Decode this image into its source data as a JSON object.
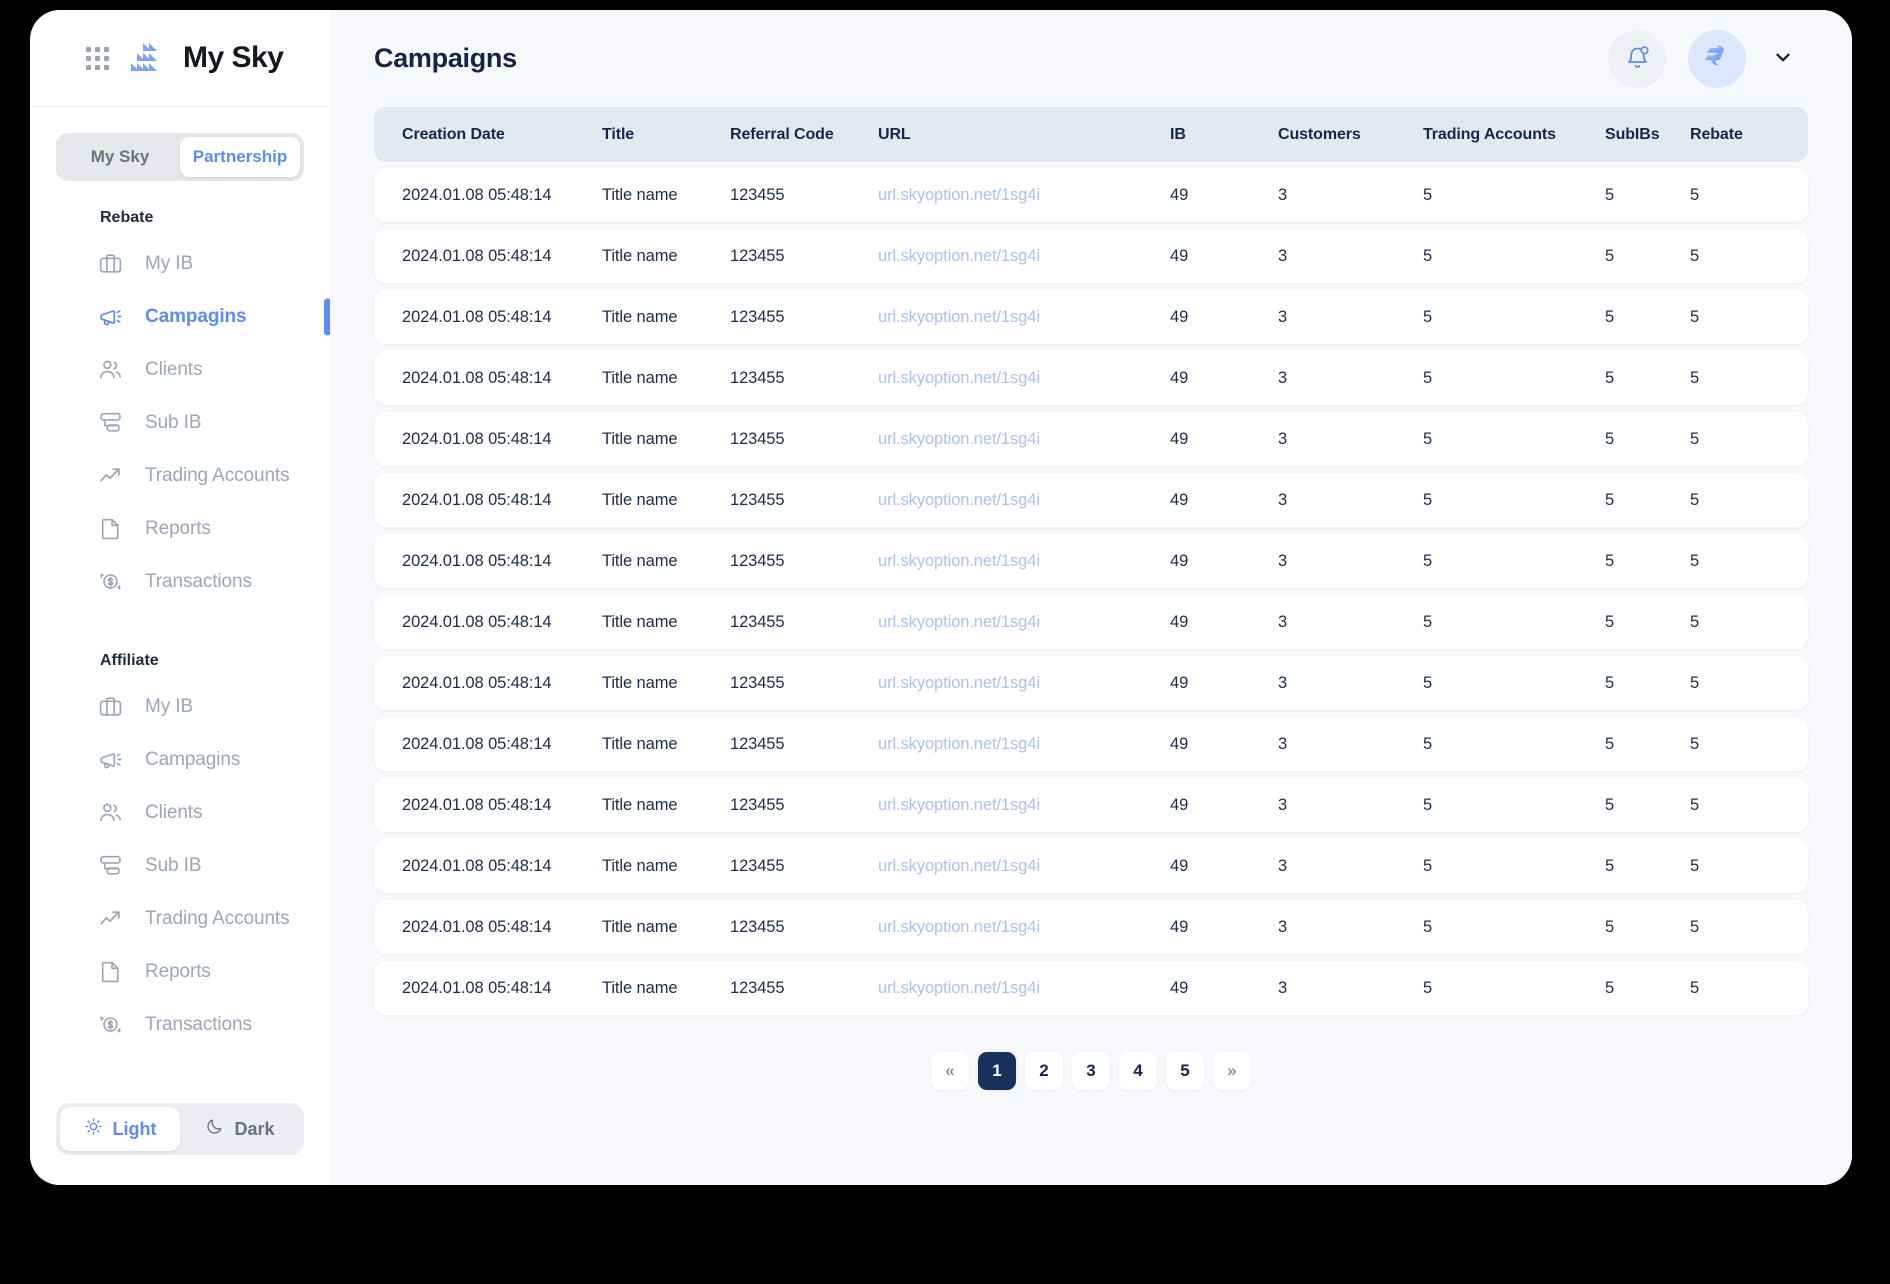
{
  "brand": {
    "name": "My Sky",
    "logo_icon": "sky-chart-logo-icon",
    "apps_icon": "apps-grid-icon"
  },
  "workspace_switch": {
    "options": [
      "My Sky",
      "Partnership"
    ],
    "selected": "Partnership"
  },
  "sidebar": {
    "groups": [
      {
        "title": "Rebate",
        "items": [
          {
            "label": "My IB",
            "icon": "briefcase-icon",
            "active": false
          },
          {
            "label": "Campagins",
            "icon": "megaphone-icon",
            "active": true
          },
          {
            "label": "Clients",
            "icon": "users-icon",
            "active": false
          },
          {
            "label": "Sub IB",
            "icon": "hierarchy-icon",
            "active": false
          },
          {
            "label": "Trading Accounts",
            "icon": "trend-up-icon",
            "active": false
          },
          {
            "label": "Reports",
            "icon": "document-icon",
            "active": false
          },
          {
            "label": "Transactions",
            "icon": "dollar-refresh-icon",
            "active": false
          }
        ]
      },
      {
        "title": "Affiliate",
        "items": [
          {
            "label": "My IB",
            "icon": "briefcase-icon",
            "active": false
          },
          {
            "label": "Campagins",
            "icon": "megaphone-icon",
            "active": false
          },
          {
            "label": "Clients",
            "icon": "users-icon",
            "active": false
          },
          {
            "label": "Sub IB",
            "icon": "hierarchy-icon",
            "active": false
          },
          {
            "label": "Trading Accounts",
            "icon": "trend-up-icon",
            "active": false
          },
          {
            "label": "Reports",
            "icon": "document-icon",
            "active": false
          },
          {
            "label": "Transactions",
            "icon": "dollar-refresh-icon",
            "active": false
          }
        ]
      }
    ]
  },
  "theme_toggle": {
    "options": [
      {
        "label": "Light",
        "icon": "sun-icon"
      },
      {
        "label": "Dark",
        "icon": "moon-icon"
      }
    ],
    "selected": "Light"
  },
  "header": {
    "title": "Campaigns",
    "notifications_icon": "bell-icon",
    "avatar_icon": "user-avatar-logo",
    "chevron_icon": "chevron-down-icon"
  },
  "table": {
    "columns": [
      "Creation Date",
      "Title",
      "Referral Code",
      "URL",
      "IB",
      "Customers",
      "Trading Accounts",
      "SubIBs",
      "Rebate"
    ],
    "rows": [
      [
        "2024.01.08 05:48:14",
        "Title name",
        "123455",
        "url.skyoption.net/1sg4i",
        "49",
        "3",
        "5",
        "5",
        "5"
      ],
      [
        "2024.01.08 05:48:14",
        "Title name",
        "123455",
        "url.skyoption.net/1sg4i",
        "49",
        "3",
        "5",
        "5",
        "5"
      ],
      [
        "2024.01.08 05:48:14",
        "Title name",
        "123455",
        "url.skyoption.net/1sg4i",
        "49",
        "3",
        "5",
        "5",
        "5"
      ],
      [
        "2024.01.08 05:48:14",
        "Title name",
        "123455",
        "url.skyoption.net/1sg4i",
        "49",
        "3",
        "5",
        "5",
        "5"
      ],
      [
        "2024.01.08 05:48:14",
        "Title name",
        "123455",
        "url.skyoption.net/1sg4i",
        "49",
        "3",
        "5",
        "5",
        "5"
      ],
      [
        "2024.01.08 05:48:14",
        "Title name",
        "123455",
        "url.skyoption.net/1sg4i",
        "49",
        "3",
        "5",
        "5",
        "5"
      ],
      [
        "2024.01.08 05:48:14",
        "Title name",
        "123455",
        "url.skyoption.net/1sg4i",
        "49",
        "3",
        "5",
        "5",
        "5"
      ],
      [
        "2024.01.08 05:48:14",
        "Title name",
        "123455",
        "url.skyoption.net/1sg4i",
        "49",
        "3",
        "5",
        "5",
        "5"
      ],
      [
        "2024.01.08 05:48:14",
        "Title name",
        "123455",
        "url.skyoption.net/1sg4i",
        "49",
        "3",
        "5",
        "5",
        "5"
      ],
      [
        "2024.01.08 05:48:14",
        "Title name",
        "123455",
        "url.skyoption.net/1sg4i",
        "49",
        "3",
        "5",
        "5",
        "5"
      ],
      [
        "2024.01.08 05:48:14",
        "Title name",
        "123455",
        "url.skyoption.net/1sg4i",
        "49",
        "3",
        "5",
        "5",
        "5"
      ],
      [
        "2024.01.08 05:48:14",
        "Title name",
        "123455",
        "url.skyoption.net/1sg4i",
        "49",
        "3",
        "5",
        "5",
        "5"
      ],
      [
        "2024.01.08 05:48:14",
        "Title name",
        "123455",
        "url.skyoption.net/1sg4i",
        "49",
        "3",
        "5",
        "5",
        "5"
      ],
      [
        "2024.01.08 05:48:14",
        "Title name",
        "123455",
        "url.skyoption.net/1sg4i",
        "49",
        "3",
        "5",
        "5",
        "5"
      ]
    ]
  },
  "pagination": {
    "prev_label": "«",
    "next_label": "»",
    "pages": [
      "1",
      "2",
      "3",
      "4",
      "5"
    ],
    "current": "1"
  },
  "colors": {
    "accent_blue": "#5b8cf7",
    "navy": "#16264d",
    "page_bg": "#f6f8fc",
    "url_link": "#a9c2f5",
    "active_page": "#16325c"
  }
}
